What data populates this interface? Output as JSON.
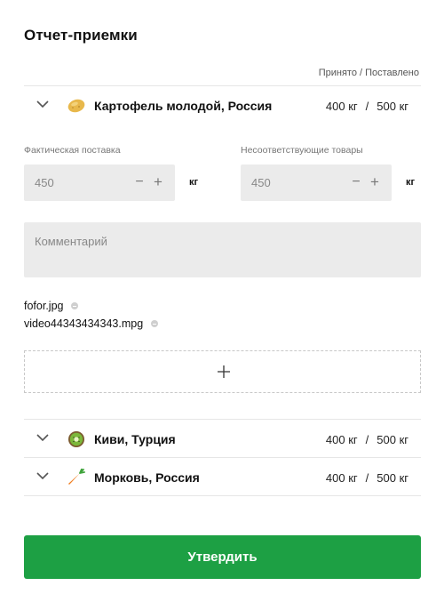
{
  "page": {
    "title": "Отчет-приемки"
  },
  "table": {
    "column_header": "Принято / Поставлено"
  },
  "products": [
    {
      "name": "Картофель молодой, Россия",
      "icon": "potato-icon",
      "accepted": "400 кг",
      "delivered": "500 кг",
      "separator": "/"
    },
    {
      "name": "Киви, Турция",
      "icon": "kiwi-icon",
      "accepted": "400 кг",
      "delivered": "500 кг",
      "separator": "/"
    },
    {
      "name": "Морковь, Россия",
      "icon": "carrot-icon",
      "accepted": "400 кг",
      "delivered": "500 кг",
      "separator": "/"
    }
  ],
  "form": {
    "actual_label": "Фактическая поставка",
    "actual_value": "450",
    "actual_unit": "кг",
    "nonconforming_label": "Несоответствующие товары",
    "nonconforming_value": "450",
    "nonconforming_unit": "кг",
    "minus": "−",
    "plus": "+",
    "comment_placeholder": "Комментарий"
  },
  "files": [
    {
      "name": "fofor.jpg"
    },
    {
      "name": "video44343434343.mpg"
    }
  ],
  "actions": {
    "submit_label": "Утвердить"
  },
  "colors": {
    "accent": "#1da044",
    "field_bg": "#ebebeb",
    "divider": "#e6e6e6"
  }
}
